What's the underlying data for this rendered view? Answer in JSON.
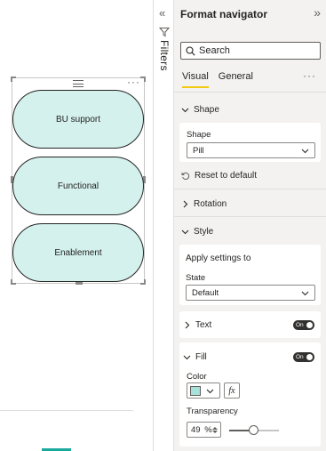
{
  "canvas": {
    "buttons": [
      {
        "label": "BU support"
      },
      {
        "label": "Functional"
      },
      {
        "label": "Enablement"
      }
    ],
    "button_fill_color": "#d4f1ed",
    "page_tab_accent_color": "#1aa99c"
  },
  "filters_rail": {
    "label": "Filters",
    "collapse_icon": "double-chevron-left-icon",
    "filter_icon": "funnel-icon"
  },
  "format_pane": {
    "title": "Format navigator",
    "expand_icon": "double-chevron-right-icon",
    "search": {
      "placeholder": "Search",
      "value": ""
    },
    "tabs": [
      {
        "label": "Visual",
        "active": true
      },
      {
        "label": "General",
        "active": false
      }
    ],
    "more_options": "···",
    "sections": {
      "shape": {
        "header": "Shape",
        "expanded": true,
        "field_label": "Shape",
        "selected": "Pill",
        "reset_label": "Reset to default"
      },
      "rotation": {
        "header": "Rotation",
        "expanded": false
      },
      "style": {
        "header": "Style",
        "expanded": true,
        "apply_label": "Apply settings to",
        "state_label": "State",
        "state_selected": "Default"
      },
      "text": {
        "header": "Text",
        "expanded": false,
        "toggle": "On"
      },
      "fill": {
        "header": "Fill",
        "expanded": true,
        "toggle": "On",
        "color_label": "Color",
        "color_value": "#a8e0da",
        "fx_label": "fx",
        "transparency_label": "Transparency",
        "transparency_value": "49",
        "transparency_unit": "%",
        "transparency_fraction": 0.49
      }
    }
  },
  "accent_colors": {
    "active_tab_underline": "#f2c811"
  }
}
